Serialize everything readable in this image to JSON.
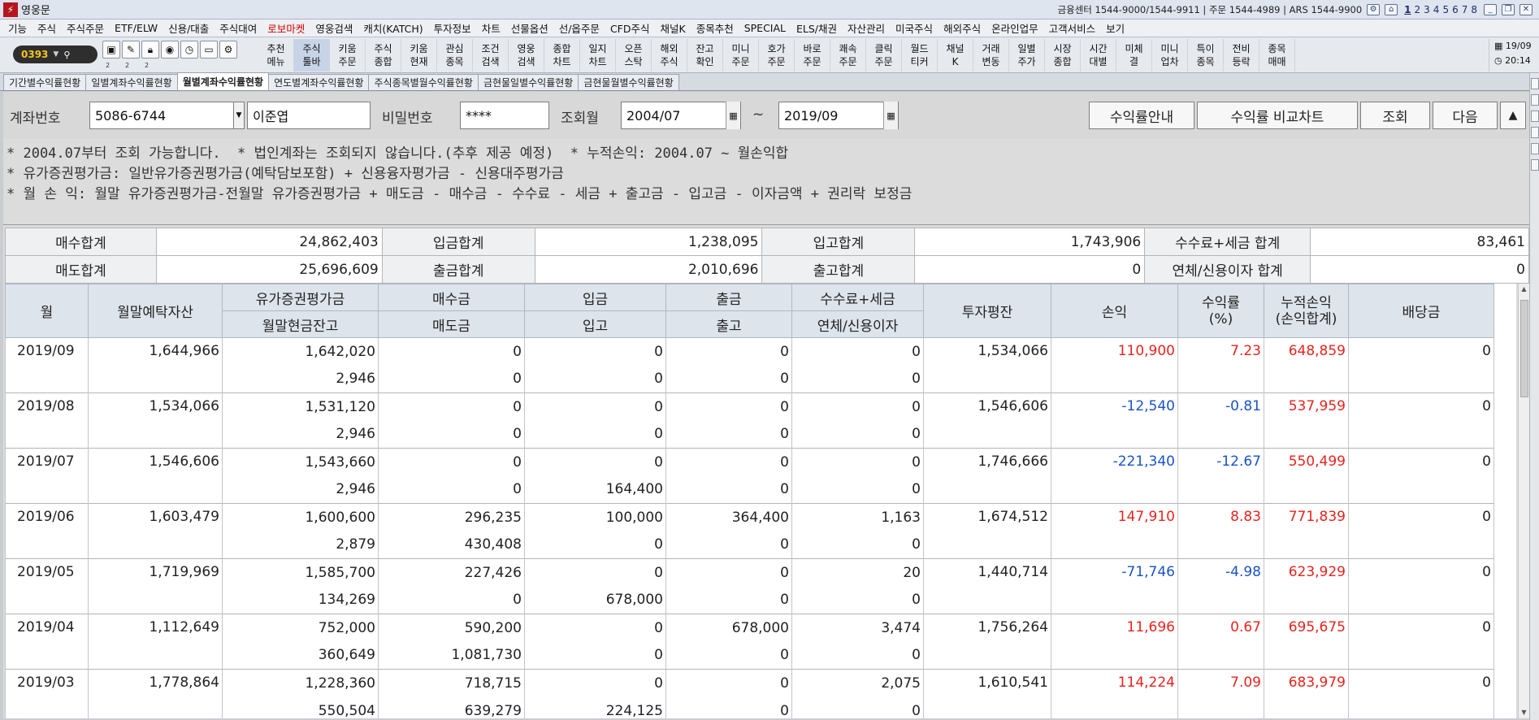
{
  "titlebar": {
    "title": "영웅문",
    "info": "금융센터 1544-9000/1544-9911 | 주문 1544-4989 | ARS 1544-9900",
    "screen_numbers": [
      "1",
      "2",
      "3",
      "4",
      "5",
      "6",
      "7",
      "8"
    ]
  },
  "menu": [
    "기능",
    "주식",
    "주식주문",
    "ETF/ELW",
    "신용/대출",
    "주식대여",
    "로보마켓",
    "영웅검색",
    "캐치(KATCH)",
    "투자정보",
    "차트",
    "선물옵션",
    "선/옵주문",
    "CFD주식",
    "채널K",
    "종목추천",
    "SPECIAL",
    "ELS/채권",
    "자산관리",
    "미국주식",
    "해외주식",
    "온라인업무",
    "고객서비스",
    "보기"
  ],
  "toolbar": {
    "account_code": "0393",
    "tool_labels": [
      "2",
      "2",
      "2"
    ],
    "quick_buttons": [
      "추천\n메뉴",
      "주식\n툴바",
      "키움\n주문",
      "주식\n종합",
      "키움\n현재",
      "관심\n종목",
      "조건\n검색",
      "영웅\n검색",
      "종합\n차트",
      "일지\n차트",
      "오픈\n스탁",
      "해외\n주식",
      "잔고\n확인",
      "미니\n주문",
      "호가\n주문",
      "바로\n주문",
      "쾌속\n주문",
      "클릭\n주문",
      "월드\n티커",
      "채널\nK",
      "거래\n변동",
      "일별\n주가",
      "시장\n종합",
      "시간\n대별",
      "미체\n결",
      "미니\n업차",
      "특이\n종목",
      "전비\n등락",
      "종목\n매매"
    ],
    "date": "19/09",
    "time": "20:14"
  },
  "tabs": [
    "기간별수익률현황",
    "일별계좌수익률현황",
    "월별계좌수익률현황",
    "연도별계좌수익률현황",
    "주식종목별월수익률현황",
    "금현물일별수익률현황",
    "금현물월별수익률현황"
  ],
  "search": {
    "account_label": "계좌번호",
    "account_number": "5086-6744",
    "account_name": "이준엽",
    "password_label": "비밀번호",
    "password_value": "****",
    "month_label": "조회월",
    "from_month": "2004/07",
    "tilde": "~",
    "to_month": "2019/09",
    "btn_guide": "수익률안내",
    "btn_chart": "수익률 비교차트",
    "btn_query": "조회",
    "btn_next": "다음",
    "btn_up": "▲"
  },
  "notes": [
    "* 2004.07부터 조회 가능합니다.  * 법인계좌는 조회되지 않습니다.(추후 제공 예정)  * 누적손익: 2004.07 ~ 월손익합",
    "* 유가증권평가금: 일반유가증권평가금(예탁담보포함) + 신용융자평가금 - 신용대주평가금",
    "* 월 손 익: 월말 유가증권평가금-전월말 유가증권평가금 + 매도금 - 매수금 - 수수료 - 세금 + 출고금 - 입고금 - 이자금액 + 권리락 보정금"
  ],
  "summary": [
    [
      {
        "label": "매수합계",
        "value": "24,862,403"
      },
      {
        "label": "입금합계",
        "value": "1,238,095"
      },
      {
        "label": "입고합계",
        "value": "1,743,906"
      },
      {
        "label": "수수료+세금 합계",
        "value": "83,461"
      }
    ],
    [
      {
        "label": "매도합계",
        "value": "25,696,609"
      },
      {
        "label": "출금합계",
        "value": "2,010,696"
      },
      {
        "label": "출고합계",
        "value": "0"
      },
      {
        "label": "연체/신용이자 합계",
        "value": "0"
      }
    ]
  ],
  "grid": {
    "headers": {
      "month": "월",
      "eom_deposit": "월말예탁자산",
      "sec_eval": "유가증권평가금",
      "cash_bal": "월말현금잔고",
      "buy": "매수금",
      "sell": "매도금",
      "deposit": "입금",
      "in_stock": "입고",
      "withdraw": "출금",
      "out_stock": "출고",
      "fee_tax": "수수료+세금",
      "interest": "연체/신용이자",
      "avg_invest": "투자평잔",
      "pnl": "손익",
      "ret": "수익률\n(%)",
      "cum": "누적손익\n(손익합계)",
      "div": "배당금"
    },
    "rows": [
      {
        "month": "2019/09",
        "eom": "1,644,966",
        "sec": "1,642,020",
        "cash": "2,946",
        "buy": "0",
        "sell": "0",
        "dep": "0",
        "instk": "0",
        "wd": "0",
        "outstk": "0",
        "fee": "0",
        "int": "0",
        "avg": "1,534,066",
        "pnl": "110,900",
        "ret": "7.23",
        "cum": "648,859",
        "div": "0",
        "sign": "pos"
      },
      {
        "month": "2019/08",
        "eom": "1,534,066",
        "sec": "1,531,120",
        "cash": "2,946",
        "buy": "0",
        "sell": "0",
        "dep": "0",
        "instk": "0",
        "wd": "0",
        "outstk": "0",
        "fee": "0",
        "int": "0",
        "avg": "1,546,606",
        "pnl": "-12,540",
        "ret": "-0.81",
        "cum": "537,959",
        "div": "0",
        "sign": "neg"
      },
      {
        "month": "2019/07",
        "eom": "1,546,606",
        "sec": "1,543,660",
        "cash": "2,946",
        "buy": "0",
        "sell": "0",
        "dep": "0",
        "instk": "164,400",
        "wd": "0",
        "outstk": "0",
        "fee": "0",
        "int": "0",
        "avg": "1,746,666",
        "pnl": "-221,340",
        "ret": "-12.67",
        "cum": "550,499",
        "div": "0",
        "sign": "neg"
      },
      {
        "month": "2019/06",
        "eom": "1,603,479",
        "sec": "1,600,600",
        "cash": "2,879",
        "buy": "296,235",
        "sell": "430,408",
        "dep": "100,000",
        "instk": "0",
        "wd": "364,400",
        "outstk": "0",
        "fee": "1,163",
        "int": "0",
        "avg": "1,674,512",
        "pnl": "147,910",
        "ret": "8.83",
        "cum": "771,839",
        "div": "0",
        "sign": "pos"
      },
      {
        "month": "2019/05",
        "eom": "1,719,969",
        "sec": "1,585,700",
        "cash": "134,269",
        "buy": "227,426",
        "sell": "0",
        "dep": "0",
        "instk": "678,000",
        "wd": "0",
        "outstk": "0",
        "fee": "20",
        "int": "0",
        "avg": "1,440,714",
        "pnl": "-71,746",
        "ret": "-4.98",
        "cum": "623,929",
        "div": "0",
        "sign": "neg"
      },
      {
        "month": "2019/04",
        "eom": "1,112,649",
        "sec": "752,000",
        "cash": "360,649",
        "buy": "590,200",
        "sell": "1,081,730",
        "dep": "0",
        "instk": "0",
        "wd": "678,000",
        "outstk": "0",
        "fee": "3,474",
        "int": "0",
        "avg": "1,756,264",
        "pnl": "11,696",
        "ret": "0.67",
        "cum": "695,675",
        "div": "0",
        "sign": "pos"
      },
      {
        "month": "2019/03",
        "eom": "1,778,864",
        "sec": "1,228,360",
        "cash": "550,504",
        "buy": "718,715",
        "sell": "639,279",
        "dep": "0",
        "instk": "224,125",
        "wd": "0",
        "outstk": "0",
        "fee": "2,075",
        "int": "0",
        "avg": "1,610,541",
        "pnl": "114,224",
        "ret": "7.09",
        "cum": "683,979",
        "div": "0",
        "sign": "pos"
      }
    ]
  },
  "colors": {
    "positive": "#e8231e",
    "negative": "#1a52c8",
    "header_bg": "#dde4ec",
    "accent_red": "#d30000"
  }
}
